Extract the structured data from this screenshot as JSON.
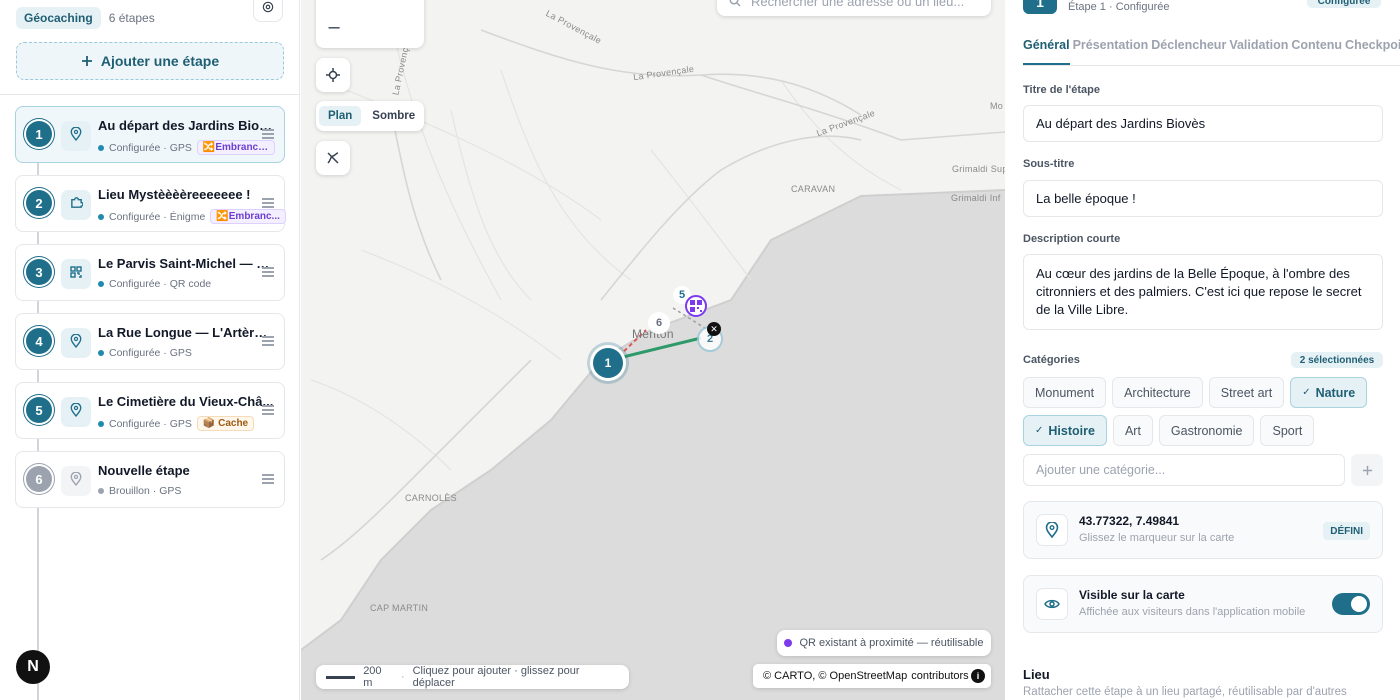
{
  "sidebar": {
    "mode_label": "Géocaching",
    "step_count": "6 étapes",
    "add_step_label": "Ajouter une étape",
    "steps": [
      {
        "number": "1",
        "title": "Au départ des Jardins Biovès",
        "status": "Configurée · GPS",
        "tag": "🔀Embranch...",
        "tag_type": "branch",
        "icon": "map-pin-icon"
      },
      {
        "number": "2",
        "title": "Lieu Mystèèèèreeeeeee !",
        "status": "Configurée · Énigme",
        "tag": "🔀Embranc...",
        "tag_type": "branch",
        "icon": "puzzle-icon"
      },
      {
        "number": "3",
        "title": "Le Parvis Saint-Michel — L...",
        "status": "Configurée · QR code",
        "tag": "",
        "icon": "qr-code-icon"
      },
      {
        "number": "4",
        "title": "La Rue Longue — L'Artère ...",
        "status": "Configurée · GPS",
        "tag": "",
        "icon": "map-pin-icon"
      },
      {
        "number": "5",
        "title": "Le Cimetière du Vieux-Châ...",
        "status": "Configurée · GPS",
        "tag": "📦 Cache",
        "tag_type": "cache",
        "icon": "map-pin-icon"
      },
      {
        "number": "6",
        "title": "Nouvelle étape",
        "status": "Brouillon · GPS",
        "tag": "",
        "icon": "map-pin-icon",
        "draft": true
      }
    ],
    "user_initial": "N"
  },
  "map": {
    "style_options": [
      "Plan",
      "Sombre"
    ],
    "active_style": "Plan",
    "search_placeholder": "Rechercher une adresse ou un lieu...",
    "labels": {
      "la_provencale": "La Provençale",
      "la_provencale_2": "La Provençale",
      "la_provencale_3": "La Provençale",
      "la_provencale_v": "La Provençale",
      "caravan": "CARAVAN",
      "grimaldi_sup": "Grimaldi Sup",
      "grimaldi_inf": "Grimaldi Inf",
      "mo": "Mo",
      "menton": "Menton",
      "carnoles": "CARNOLÈS",
      "cap_martin": "CAP MARTIN"
    },
    "pins": {
      "p1": "1",
      "p2": "2",
      "p5": "5",
      "p6": "6",
      "px": "✕"
    },
    "qr_hint": "QR existant à proximité — réutilisable",
    "scale_label": "200 m",
    "scale_hint": "Cliquez pour ajouter · glissez pour déplacer",
    "attribution_prefix": "© CARTO, © OpenStreetMap",
    "attribution_link": "contributors",
    "info": "i"
  },
  "panel": {
    "step_number": "1",
    "subtitle": "Étape 1 · Configurée",
    "status_badge": "Configurée",
    "tabs": [
      "Général",
      "Présentation",
      "Déclencheur",
      "Validation",
      "Contenu",
      "Checkpoint"
    ],
    "active_tab": "Général",
    "title_label": "Titre de l'étape",
    "title_value": "Au départ des Jardins Biovès",
    "subtitle_label": "Sous-titre",
    "subtitle_value": "La belle époque !",
    "desc_label": "Description courte",
    "desc_value": "Au cœur des jardins de la Belle Époque, à l'ombre des citronniers et des palmiers. C'est ici que repose le secret de la Ville Libre.",
    "categories_label": "Catégories",
    "selected_count": "2 sélectionnées",
    "categories": [
      {
        "label": "Monument",
        "selected": false
      },
      {
        "label": "Architecture",
        "selected": false
      },
      {
        "label": "Street art",
        "selected": false
      },
      {
        "label": "Nature",
        "selected": true
      },
      {
        "label": "Histoire",
        "selected": true
      },
      {
        "label": "Art",
        "selected": false
      },
      {
        "label": "Gastronomie",
        "selected": false
      },
      {
        "label": "Sport",
        "selected": false
      }
    ],
    "add_category_placeholder": "Ajouter une catégorie...",
    "coords": "43.77322, 7.49841",
    "coords_hint": "Glissez le marqueur sur la carte",
    "coords_badge": "DÉFINI",
    "visible_title": "Visible sur la carte",
    "visible_hint": "Affichée aux visiteurs dans l'application mobile",
    "visible_on": true,
    "lieu_title": "Lieu",
    "lieu_hint": "Rattacher cette étape à un lieu partagé, réutilisable par d'autres"
  },
  "colors": {
    "accent": "#1f6f8b",
    "accent_light": "#e6f1f5",
    "branch": "#6d3fd1",
    "route_green": "#2e9a6a",
    "route_red": "#e05555"
  }
}
